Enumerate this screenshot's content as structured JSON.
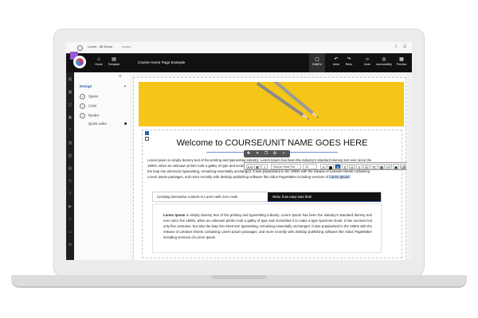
{
  "browser": {
    "tab_title": "Lorem - 88 Demo",
    "tab_subtitle": "Lorem",
    "icons": [
      "refresh-icon",
      "share-icon",
      "menu-icon"
    ]
  },
  "toolbar": {
    "home_label": "Home",
    "template_label": "Template",
    "page_name": "Course Home Page Example",
    "edit_label": "Edit/Ed",
    "undo_label": "Undo",
    "redo_label": "Redo",
    "code_label": "Code",
    "accessibility_label": "Accessibility",
    "preview_label": "Preview"
  },
  "panel": {
    "collapse": "«",
    "design_title": "Design",
    "design_arrow": "▼",
    "properties": [
      "Space",
      "Color",
      "Border"
    ],
    "quick_links": "Quick Links"
  },
  "content": {
    "heading": "Welcome to COURSE/UNIT NAME GOES HERE",
    "paragraph_start": "Lorem ipsum is simply dummy text of the printing and typesetting industry. Lorem Ipsum has been the industry's standard dummy text ever since the 1500s, when an unknown printer took a galley of type and scrambled it to make a type specimen book. It has survived not only five centuries, but also the leap into electronic typesetting, remaining essentially unchanged. It was popularised in the 1960s with the release of Letraset sheets containing Lorem Ipsum passages, and more recently with desktop publishing software like Aldus PageMaker including versions of",
    "paragraph_selected": "Lorem Ipsum.",
    "formatting": {
      "aa_button": "AA",
      "bold_button": "B",
      "italic_button": "I",
      "font_value": "Source Sans Pro",
      "size_value": "13",
      "tt_button": "Tt"
    },
    "tabs": [
      {
        "label": "Creating interactive content in Lorem with zero code"
      },
      {
        "label": "Wow, how easy was that!"
      }
    ],
    "tab_panel_bold": "Lorem Ipsum",
    "tab_panel_text": " is simply dummy text of the printing and typesetting industry. Lorem Ipsum has been the industry's standard dummy text ever since the 1500s, when an unknown printer took a galley of type and scrambled it to make a type specimen book. It has survived not only five centuries, but also the leap into electronic typesetting, remaining essentially unchanged. It was popularised in the 1960s with the release of Letraset sheets containing Lorem Ipsum passages, and more recently with desktop publishing software like Aldus PageMaker including versions of Lorem Ipsum."
  },
  "colors": {
    "toolbar": "#111111",
    "accent": "#2a5db0",
    "hero": "#f5c518",
    "logo_purple": "#9b59d0"
  }
}
